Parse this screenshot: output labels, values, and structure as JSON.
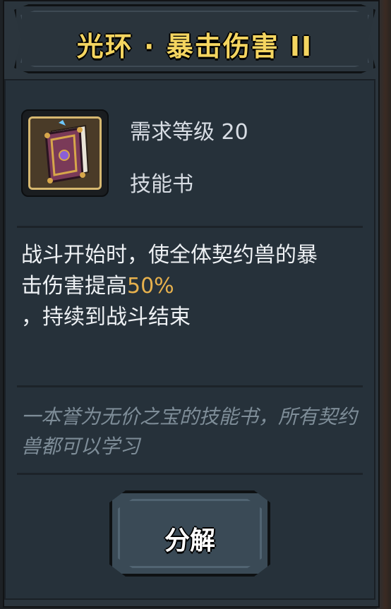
{
  "title": "光环 · 暴击伤害 II",
  "item": {
    "icon": "skill-book-icon",
    "required_level": "需求等级 20",
    "type": "技能书"
  },
  "description": {
    "line1": "战斗开始时，使全体契约兽的暴",
    "line2_prefix": "击伤害提高",
    "line2_highlight": "50%",
    "line3": "，持续到战斗结束"
  },
  "flavor_text": "一本誉为无价之宝的技能书，所有契约兽都可以学习",
  "actions": {
    "decompose_label": "分解"
  },
  "colors": {
    "title": "#f4d560",
    "highlight": "#e7b14d",
    "flavor": "#7e8d98",
    "panel": "#2b353d"
  }
}
